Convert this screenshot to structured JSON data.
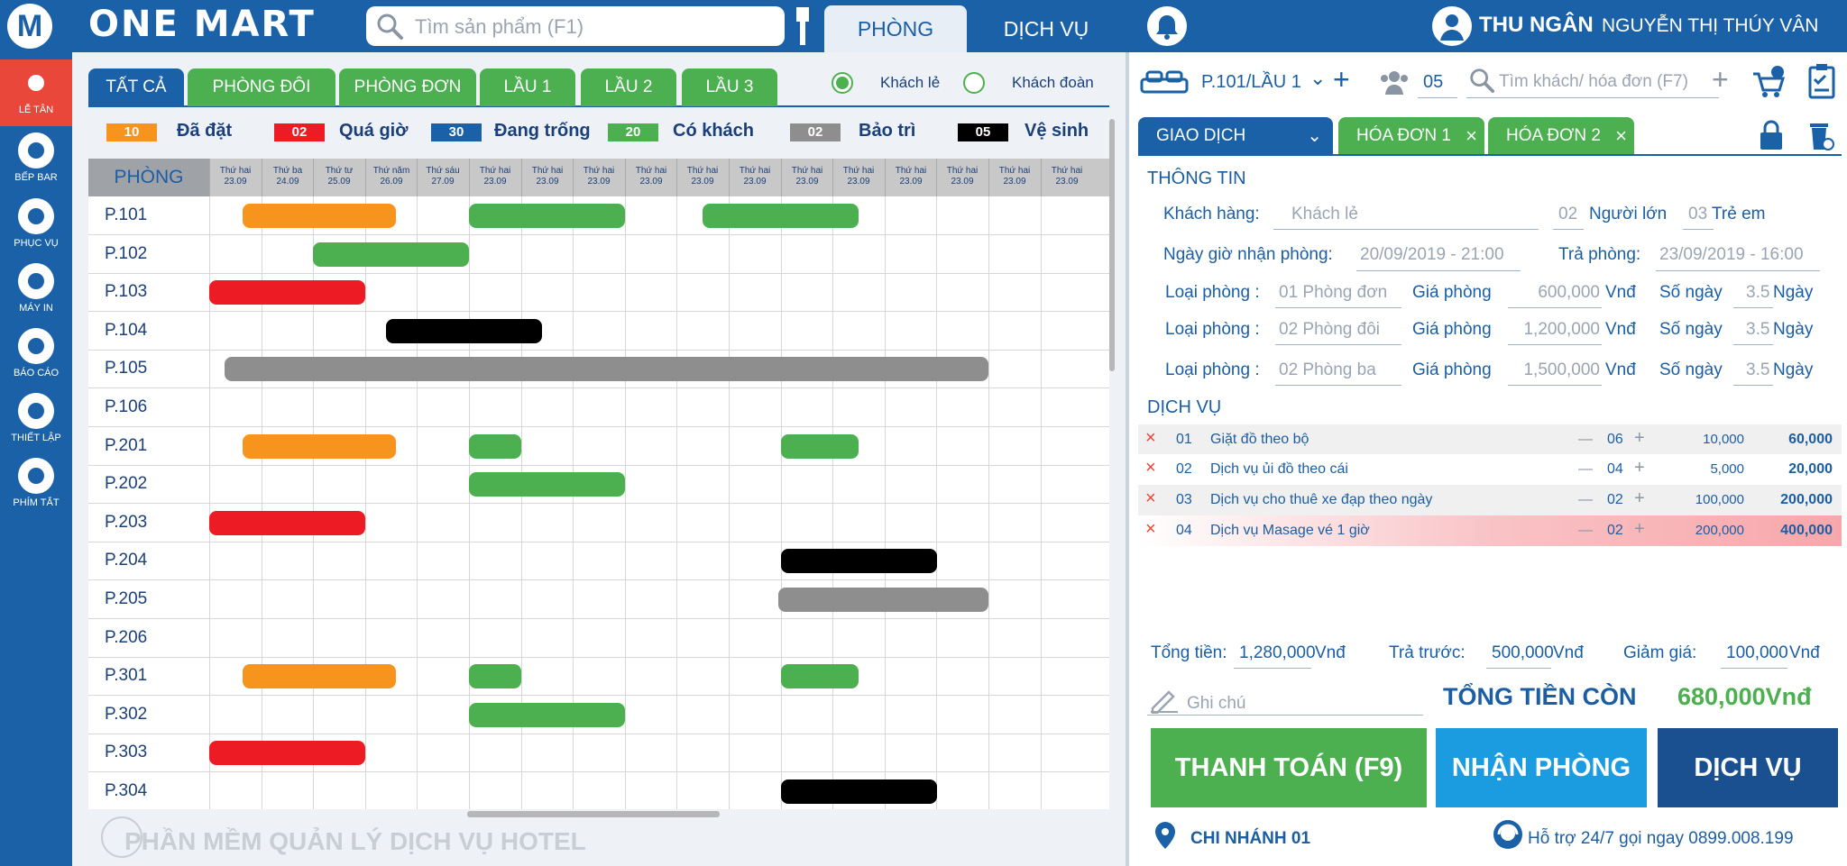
{
  "app": {
    "logo_letter": "M",
    "brand": "ONE MART"
  },
  "search": {
    "placeholder": "Tìm sản phẩm (F1)"
  },
  "top_tabs": [
    {
      "label": "PHÒNG"
    },
    {
      "label": "DỊCH VỤ"
    }
  ],
  "user": {
    "role": "THU NGÂN",
    "name": "NGUYỄN THỊ THÚY VÂN"
  },
  "sidebar": [
    {
      "label": "LỄ TÂN",
      "icon": "building-icon"
    },
    {
      "label": "BẾP BAR",
      "icon": "chef-icon"
    },
    {
      "label": "PHỤC VỤ",
      "icon": "cloche-icon"
    },
    {
      "label": "MÁY IN",
      "icon": "printer-icon"
    },
    {
      "label": "BÁO CÁO",
      "icon": "report-icon"
    },
    {
      "label": "THIẾT LẬP",
      "icon": "gear-icon"
    },
    {
      "label": "PHÍM TẮT",
      "icon": "help-icon"
    }
  ],
  "filter_tabs": [
    "TẤT CẢ",
    "PHÒNG ĐÔI",
    "PHÒNG ĐƠN",
    "LẦU 1",
    "LẦU 2",
    "LẦU 3"
  ],
  "guest_type": {
    "options": [
      "Khách lẻ",
      "Khách đoàn"
    ],
    "selected": "Khách lẻ"
  },
  "legend": [
    {
      "count": "10",
      "label": "Đã đặt",
      "color": "#f7941d"
    },
    {
      "count": "02",
      "label": "Quá giờ",
      "color": "#ed1c24"
    },
    {
      "count": "30",
      "label": "Đang trống",
      "color": "#1a61a8"
    },
    {
      "count": "20",
      "label": "Có khách",
      "color": "#4caf50"
    },
    {
      "count": "02",
      "label": "Bảo trì",
      "color": "#8e8e8e"
    },
    {
      "count": "05",
      "label": "Vệ sinh",
      "color": "#000000"
    }
  ],
  "schedule": {
    "room_header": "PHÒNG",
    "days": [
      {
        "dow": "Thứ hai",
        "date": "23.09"
      },
      {
        "dow": "Thứ ba",
        "date": "24.09"
      },
      {
        "dow": "Thứ tư",
        "date": "25.09"
      },
      {
        "dow": "Thứ năm",
        "date": "26.09"
      },
      {
        "dow": "Thứ sáu",
        "date": "27.09"
      },
      {
        "dow": "Thứ hai",
        "date": "23.09"
      },
      {
        "dow": "Thứ hai",
        "date": "23.09"
      },
      {
        "dow": "Thứ hai",
        "date": "23.09"
      },
      {
        "dow": "Thứ hai",
        "date": "23.09"
      },
      {
        "dow": "Thứ hai",
        "date": "23.09"
      },
      {
        "dow": "Thứ hai",
        "date": "23.09"
      },
      {
        "dow": "Thứ hai",
        "date": "23.09"
      },
      {
        "dow": "Thứ hai",
        "date": "23.09"
      },
      {
        "dow": "Thứ hai",
        "date": "23.09"
      },
      {
        "dow": "Thứ hai",
        "date": "23.09"
      },
      {
        "dow": "Thứ hai",
        "date": "23.09"
      },
      {
        "dow": "Thứ hai",
        "date": "23.09"
      }
    ],
    "rooms": [
      {
        "name": "P.101",
        "bookings": [
          {
            "start": 0.65,
            "end": 3.6,
            "status": "booked"
          },
          {
            "start": 5,
            "end": 8,
            "status": "occupied"
          },
          {
            "start": 9.5,
            "end": 12.5,
            "status": "occupied"
          }
        ]
      },
      {
        "name": "P.102",
        "bookings": [
          {
            "start": 2,
            "end": 5,
            "status": "occupied"
          }
        ]
      },
      {
        "name": "P.103",
        "bookings": [
          {
            "start": 0,
            "end": 3,
            "status": "overdue"
          }
        ]
      },
      {
        "name": "P.104",
        "bookings": [
          {
            "start": 3.4,
            "end": 6.4,
            "status": "cleaning"
          }
        ]
      },
      {
        "name": "P.105",
        "bookings": [
          {
            "start": 0.3,
            "end": 15,
            "status": "maintenance"
          }
        ]
      },
      {
        "name": "P.106",
        "bookings": []
      },
      {
        "name": "P.201",
        "bookings": [
          {
            "start": 0.65,
            "end": 3.6,
            "status": "booked"
          },
          {
            "start": 5,
            "end": 6,
            "status": "occupied"
          },
          {
            "start": 11,
            "end": 12.5,
            "status": "occupied"
          }
        ]
      },
      {
        "name": "P.202",
        "bookings": [
          {
            "start": 5,
            "end": 8,
            "status": "occupied"
          }
        ]
      },
      {
        "name": "P.203",
        "bookings": [
          {
            "start": 0,
            "end": 3,
            "status": "overdue"
          }
        ]
      },
      {
        "name": "P.204",
        "bookings": [
          {
            "start": 11,
            "end": 14,
            "status": "cleaning"
          }
        ]
      },
      {
        "name": "P.205",
        "bookings": [
          {
            "start": 10.95,
            "end": 15,
            "status": "maintenance"
          }
        ]
      },
      {
        "name": "P.206",
        "bookings": []
      },
      {
        "name": "P.301",
        "bookings": [
          {
            "start": 0.65,
            "end": 3.6,
            "status": "booked"
          },
          {
            "start": 5,
            "end": 6,
            "status": "occupied"
          },
          {
            "start": 11,
            "end": 12.5,
            "status": "occupied"
          }
        ]
      },
      {
        "name": "P.302",
        "bookings": [
          {
            "start": 5,
            "end": 8,
            "status": "occupied"
          }
        ]
      },
      {
        "name": "P.303",
        "bookings": [
          {
            "start": 0,
            "end": 3,
            "status": "overdue"
          }
        ]
      },
      {
        "name": "P.304",
        "bookings": [
          {
            "start": 11,
            "end": 14,
            "status": "cleaning"
          }
        ]
      }
    ]
  },
  "footer_brand": "PHẦN MỀM QUẢN LÝ DỊCH VỤ HOTEL",
  "right": {
    "room": "P.101/LẦU 1",
    "guests": "05",
    "search_placeholder": "Tìm khách/ hóa đơn (F7)",
    "tabs": [
      "GIAO DỊCH",
      "HÓA ĐƠN 1",
      "HÓA ĐƠN 2"
    ],
    "info_title": "THÔNG TIN",
    "customer_label": "Khách hàng:",
    "customer_value": "Khách lẻ",
    "adults": "02",
    "adults_label": "Người lớn",
    "children": "03",
    "children_label": "Trẻ em",
    "checkin_label": "Ngày giờ nhận phòng:",
    "checkin": "20/09/2019 - 21:00",
    "checkout_label": "Trả phòng:",
    "checkout": "23/09/2019 - 16:00",
    "room_lines": [
      {
        "type_label": "Loại phòng :",
        "type": "01 Phòng đơn",
        "price_label": "Giá phòng",
        "price": "600,000",
        "unit": "Vnđ",
        "days_label": "Số ngày",
        "days": "3.5",
        "days_unit": "Ngày"
      },
      {
        "type_label": "Loại phòng :",
        "type": "02 Phòng đôi",
        "price_label": "Giá phòng",
        "price": "1,200,000",
        "unit": "Vnđ",
        "days_label": "Số ngày",
        "days": "3.5",
        "days_unit": "Ngày"
      },
      {
        "type_label": "Loại phòng :",
        "type": "02 Phòng ba",
        "price_label": "Giá phòng",
        "price": "1,500,000",
        "unit": "Vnđ",
        "days_label": "Số ngày",
        "days": "3.5",
        "days_unit": "Ngày"
      }
    ],
    "service_title": "DỊCH VỤ",
    "services": [
      {
        "no": "01",
        "name": "Giặt đồ theo bộ",
        "qty": "06",
        "price": "10,000",
        "amount": "60,000"
      },
      {
        "no": "02",
        "name": "Dịch vụ ủi đồ theo cái",
        "qty": "04",
        "price": "5,000",
        "amount": "20,000"
      },
      {
        "no": "03",
        "name": "Dịch vụ cho thuê xe đạp theo ngày",
        "qty": "02",
        "price": "100,000",
        "amount": "200,000"
      },
      {
        "no": "04",
        "name": "Dịch vụ Masage vé 1 giờ",
        "qty": "02",
        "price": "200,000",
        "amount": "400,000"
      }
    ],
    "total_label": "Tổng tiền:",
    "total": "1,280,000",
    "prepaid_label": "Trả trước:",
    "prepaid": "500,000",
    "discount_label": "Giảm giá:",
    "discount": "100,000",
    "currency": "Vnđ",
    "note_placeholder": "Ghi chú",
    "remaining_label": "TỔNG TIỀN CÒN",
    "remaining": "680,000Vnđ",
    "btn_pay": "THANH TOÁN (F9)",
    "btn_checkin": "NHẬN PHÒNG",
    "btn_service": "DỊCH VỤ",
    "branch": "CHI NHÁNH 01",
    "support": "Hỗ trợ 24/7 gọi ngay 0899.008.199"
  },
  "colors": {
    "primary": "#1a61a8",
    "green": "#4caf50",
    "orange": "#f7941d",
    "red": "#ed1c24",
    "gray": "#8e8e8e",
    "black": "#000000"
  }
}
